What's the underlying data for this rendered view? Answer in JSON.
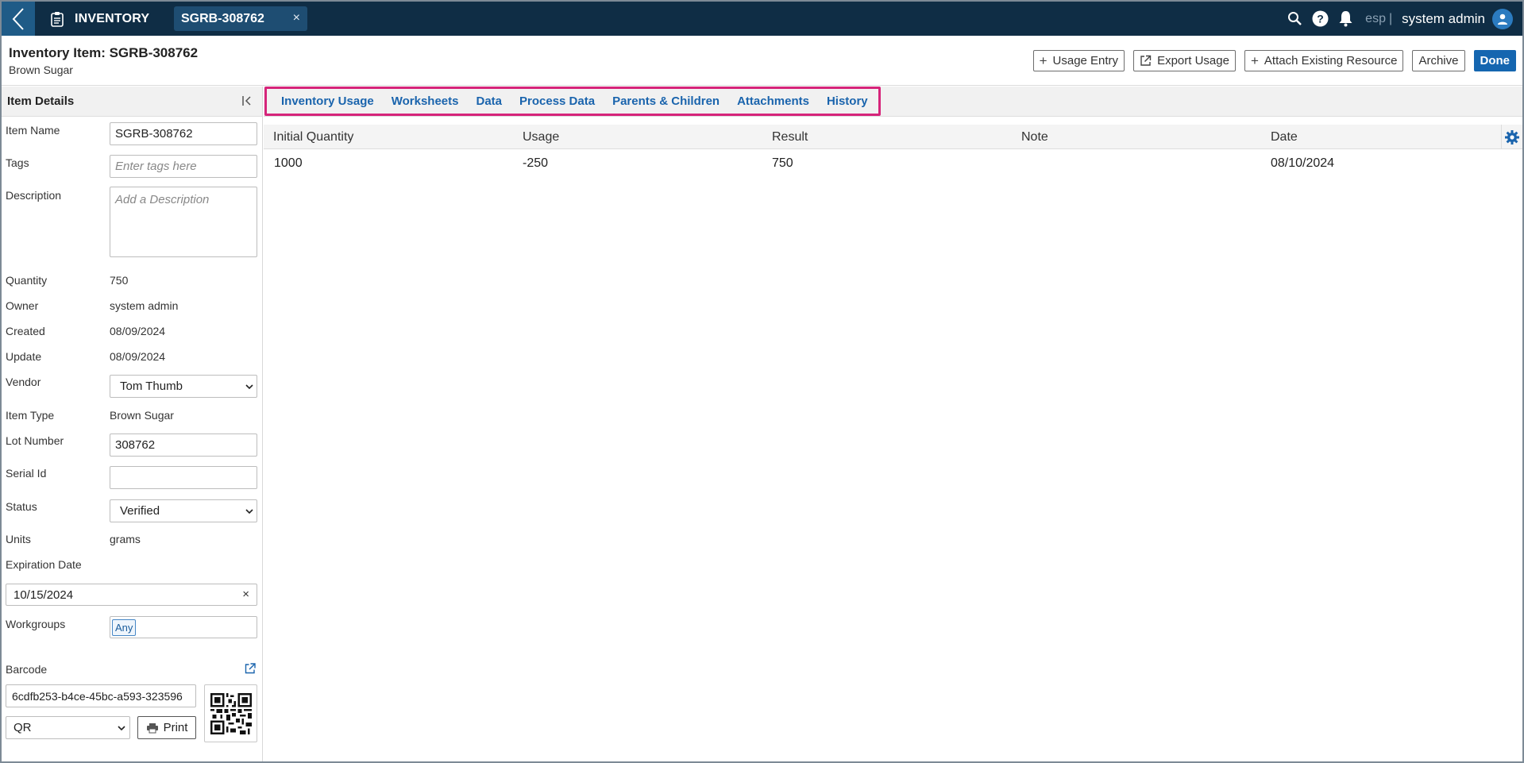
{
  "topbar": {
    "app_label": "INVENTORY",
    "record_tab": "SGRB-308762",
    "close_glyph": "×",
    "lang": "esp",
    "lang_sep": "|",
    "user": "system admin"
  },
  "header": {
    "title": "Inventory Item: SGRB-308762",
    "subtitle": "Brown Sugar",
    "actions": {
      "usage_entry": "Usage Entry",
      "export_usage": "Export Usage",
      "attach_resource": "Attach Existing Resource",
      "archive": "Archive",
      "done": "Done"
    }
  },
  "details": {
    "panel_title": "Item Details",
    "item_name_label": "Item Name",
    "item_name": "SGRB-308762",
    "tags_label": "Tags",
    "tags_placeholder": "Enter tags here",
    "description_label": "Description",
    "description_placeholder": "Add a Description",
    "quantity_label": "Quantity",
    "quantity": "750",
    "owner_label": "Owner",
    "owner": "system admin",
    "created_label": "Created",
    "created": "08/09/2024",
    "update_label": "Update",
    "update": "08/09/2024",
    "vendor_label": "Vendor",
    "vendor": "Tom Thumb",
    "item_type_label": "Item Type",
    "item_type": "Brown Sugar",
    "lot_number_label": "Lot Number",
    "lot_number": "308762",
    "serial_id_label": "Serial Id",
    "serial_id": "",
    "status_label": "Status",
    "status": "Verified",
    "units_label": "Units",
    "units": "grams",
    "expiration_label": "Expiration Date",
    "expiration": "10/15/2024",
    "workgroups_label": "Workgroups",
    "workgroup_chip": "Any",
    "barcode_label": "Barcode",
    "barcode_value": "6cdfb253-b4ce-45bc-a593-323596",
    "barcode_type": "QR",
    "print_label": "Print"
  },
  "tabs": [
    "Inventory Usage",
    "Worksheets",
    "Data",
    "Process Data",
    "Parents & Children",
    "Attachments",
    "History"
  ],
  "highlight_color": "#d6247a",
  "grid": {
    "columns": [
      "Initial Quantity",
      "Usage",
      "Result",
      "Note",
      "Date"
    ],
    "rows": [
      [
        "1000",
        "-250",
        "750",
        "",
        "08/10/2024"
      ]
    ]
  }
}
